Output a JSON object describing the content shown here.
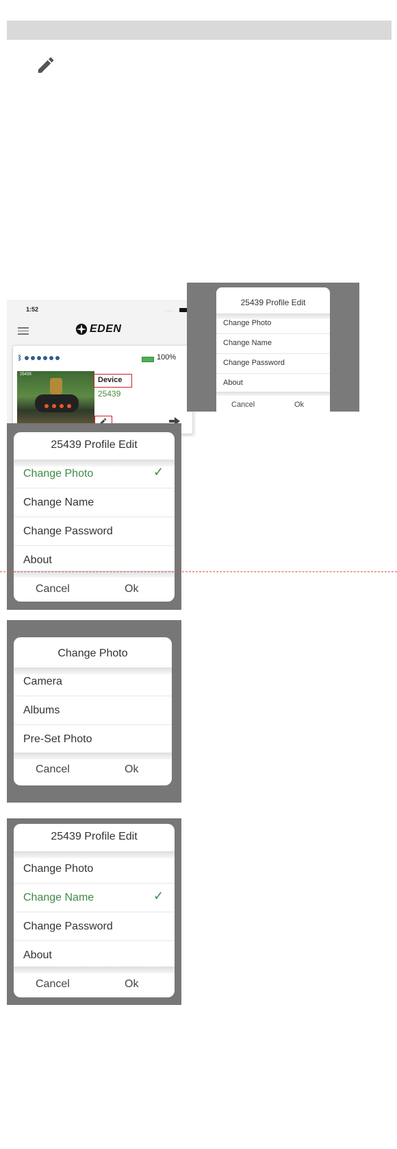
{
  "phone": {
    "time": "1:52",
    "signal": "....",
    "logo_text": "EDEN",
    "battery_pct": "100%",
    "photo_label": "25439",
    "device_label": "Device",
    "device_number": "25439"
  },
  "dialog_small": {
    "title": "25439 Profile Edit",
    "items": [
      "Change Photo",
      "Change Name",
      "Change Password",
      "About"
    ],
    "cancel": "Cancel",
    "ok": "Ok"
  },
  "dialog_photo_selected": {
    "title": "25439 Profile Edit",
    "items": [
      "Change Photo",
      "Change Name",
      "Change Password",
      "About"
    ],
    "check": "✓",
    "cancel": "Cancel",
    "ok": "Ok"
  },
  "dialog_change_photo": {
    "title": "Change Photo",
    "items": [
      "Camera",
      "Albums",
      "Pre-Set Photo"
    ],
    "cancel": "Cancel",
    "ok": "Ok"
  },
  "dialog_name_selected": {
    "title": "25439 Profile Edit",
    "items": [
      "Change Photo",
      "Change Name",
      "Change Password",
      "About"
    ],
    "check": "✓",
    "cancel": "Cancel",
    "ok": "Ok"
  },
  "colors": {
    "selected": "#3f8a47",
    "highlight_box": "#d0202a",
    "header_bar": "#d9d9d9"
  },
  "icons": {
    "pencil": "pencil-icon",
    "arrow": "arrow-right-icon",
    "bluetooth": "bluetooth-icon",
    "battery": "battery-icon",
    "menu": "menu-icon",
    "check": "check-icon"
  }
}
